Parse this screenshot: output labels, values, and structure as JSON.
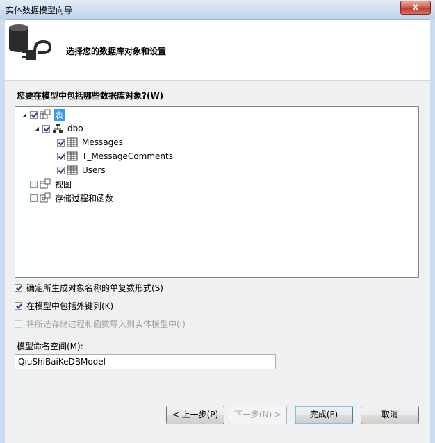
{
  "window": {
    "title": "实体数据模型向导",
    "close_glyph": "x"
  },
  "header": {
    "title": "选择您的数据库对象和设置",
    "icon": "database-plug-icon"
  },
  "question": "您要在模型中包括哪些数据库对象?(W)",
  "tree": {
    "tables": {
      "label": "表",
      "checked": true,
      "expanded": true,
      "selected": true
    },
    "dbo": {
      "label": "dbo",
      "checked": true,
      "expanded": true
    },
    "items": [
      {
        "label": "Messages",
        "checked": true
      },
      {
        "label": "T_MessageComments",
        "checked": true
      },
      {
        "label": "Users",
        "checked": true
      }
    ],
    "views": {
      "label": "视图",
      "checked": false
    },
    "procs": {
      "label": "存储过程和函数",
      "checked": false
    }
  },
  "options": {
    "pluralize": {
      "label": "确定所生成对象名称的单复数形式(S)",
      "checked": true
    },
    "foreign_keys": {
      "label": "在模型中包括外键列(K)",
      "checked": true
    },
    "import_procs": {
      "label": "将所选存储过程和函数导入到实体模型中(I)",
      "checked": false,
      "enabled": false
    }
  },
  "namespace": {
    "label": "模型命名空间(M):",
    "value": "QiuShiBaiKeDBModel"
  },
  "buttons": {
    "prev": "< 上一步(P)",
    "next": "下一步(N) >",
    "finish": "完成(F)",
    "cancel": "取消"
  }
}
